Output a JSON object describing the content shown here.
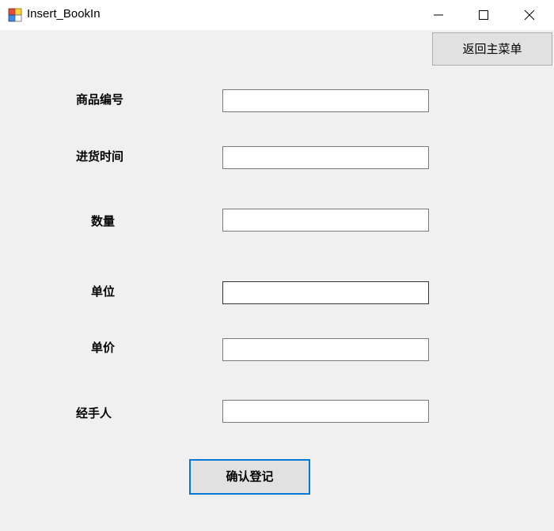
{
  "window": {
    "title": "Insert_BookIn",
    "controls": [
      "minimize-icon",
      "maximize-icon",
      "close-icon"
    ]
  },
  "toolbar": {
    "back_label": "返回主菜单"
  },
  "form": {
    "fields": [
      {
        "label": "商品编号",
        "value": ""
      },
      {
        "label": "进货时间",
        "value": ""
      },
      {
        "label": "数量",
        "value": ""
      },
      {
        "label": "单位",
        "value": ""
      },
      {
        "label": "单价",
        "value": ""
      },
      {
        "label": "经手人",
        "value": ""
      }
    ],
    "submit_label": "确认登记"
  },
  "colors": {
    "background": "#f0f0f0",
    "focus_accent": "#0078d7",
    "button_face": "#e1e1e1"
  }
}
